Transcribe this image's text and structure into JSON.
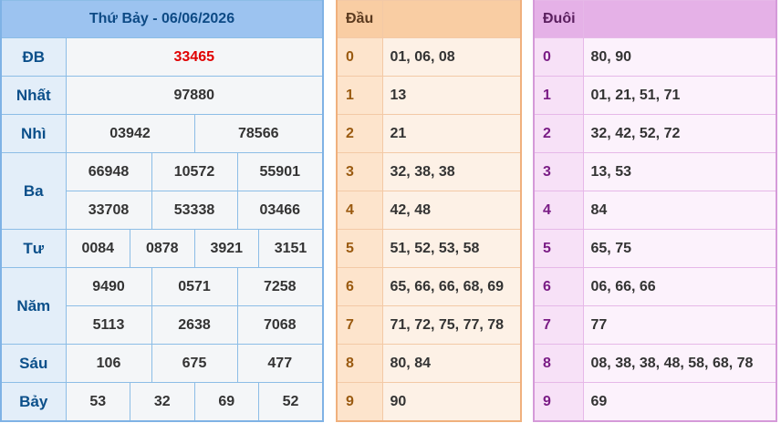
{
  "results": {
    "title": "Thứ Bảy - 06/06/2026",
    "rows": {
      "db": {
        "label": "ĐB",
        "values": [
          "33465"
        ]
      },
      "nhat": {
        "label": "Nhất",
        "values": [
          "97880"
        ]
      },
      "nhi": {
        "label": "Nhì",
        "values": [
          "03942",
          "78566"
        ]
      },
      "ba": {
        "label": "Ba",
        "values": [
          "66948",
          "10572",
          "55901",
          "33708",
          "53338",
          "03466"
        ]
      },
      "tu": {
        "label": "Tư",
        "values": [
          "0084",
          "0878",
          "3921",
          "3151"
        ]
      },
      "nam": {
        "label": "Năm",
        "values": [
          "9490",
          "0571",
          "7258",
          "5113",
          "2638",
          "7068"
        ]
      },
      "sau": {
        "label": "Sáu",
        "values": [
          "106",
          "675",
          "477"
        ]
      },
      "bay": {
        "label": "Bảy",
        "values": [
          "53",
          "32",
          "69",
          "52"
        ]
      }
    },
    "special_color": "#e00000"
  },
  "dau": {
    "header": "Đầu",
    "rows": [
      {
        "key": "0",
        "values": "01, 06, 08"
      },
      {
        "key": "1",
        "values": "13"
      },
      {
        "key": "2",
        "values": "21"
      },
      {
        "key": "3",
        "values": "32, 38, 38"
      },
      {
        "key": "4",
        "values": "42, 48"
      },
      {
        "key": "5",
        "values": "51, 52, 53, 58"
      },
      {
        "key": "6",
        "values": "65, 66, 66, 68, 69"
      },
      {
        "key": "7",
        "values": "71, 72, 75, 77, 78"
      },
      {
        "key": "8",
        "values": "80, 84"
      },
      {
        "key": "9",
        "values": "90"
      }
    ]
  },
  "duoi": {
    "header": "Đuôi",
    "rows": [
      {
        "key": "0",
        "values": "80, 90"
      },
      {
        "key": "1",
        "values": "01, 21, 51, 71"
      },
      {
        "key": "2",
        "values": "32, 42, 52, 72"
      },
      {
        "key": "3",
        "values": "13, 53"
      },
      {
        "key": "4",
        "values": "84"
      },
      {
        "key": "5",
        "values": "65, 75"
      },
      {
        "key": "6",
        "values": "06, 66, 66"
      },
      {
        "key": "7",
        "values": "77"
      },
      {
        "key": "8",
        "values": "08, 38, 38, 48, 58, 68, 78"
      },
      {
        "key": "9",
        "values": "69"
      }
    ]
  }
}
